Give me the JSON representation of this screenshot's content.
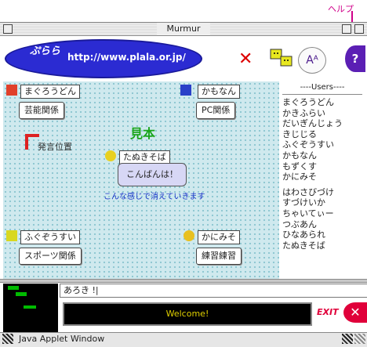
{
  "window": {
    "title": "Murmur"
  },
  "annotation": {
    "help_label": "ヘルプ"
  },
  "header": {
    "brand": "ぷらら",
    "url": "http://www.plala.or.jp/",
    "icons": [
      "mute-icon",
      "faces-icon",
      "font-icon",
      "help-icon"
    ],
    "help_glyph": "?",
    "font_glyph": "Aᴬ"
  },
  "chat": {
    "sample_label": "見本",
    "speak_position_label": "発言位置",
    "fade_hint": "こんな感じで消えていきます",
    "main_bubble": {
      "name": "たぬきそば",
      "text": "こんばんは！"
    },
    "rooms": [
      {
        "user": "まぐろうどん",
        "room": "芸能関係",
        "avatar_color": "#e0402a"
      },
      {
        "user": "かもなん",
        "room": "PC関係",
        "avatar_color": "#2a40c8"
      },
      {
        "user": "ふぐぞうすい",
        "room": "スポーツ関係",
        "avatar_color": "#d8d820"
      },
      {
        "user": "かにみそ",
        "room": "練習練習",
        "avatar_color": "#e8c020"
      }
    ]
  },
  "users": {
    "header": "----Users----",
    "group1": [
      "まぐろうどん",
      "かきふらい",
      "だいぎんじょう",
      "きじじる",
      "ふぐぞうすい",
      "かもなん",
      "もずくす",
      "かにみそ"
    ],
    "group2": [
      "はわさびづけ",
      "すづけいか",
      "ちゃいてぃー",
      "つぶあん",
      "ひなあられ",
      "たぬきそば"
    ]
  },
  "input": {
    "value": "あろき !|"
  },
  "bottom": {
    "welcome": "Welcome!",
    "exit_label": "EXIT",
    "exit_glyph": "✕"
  },
  "status": {
    "text": "Java Applet Window"
  }
}
